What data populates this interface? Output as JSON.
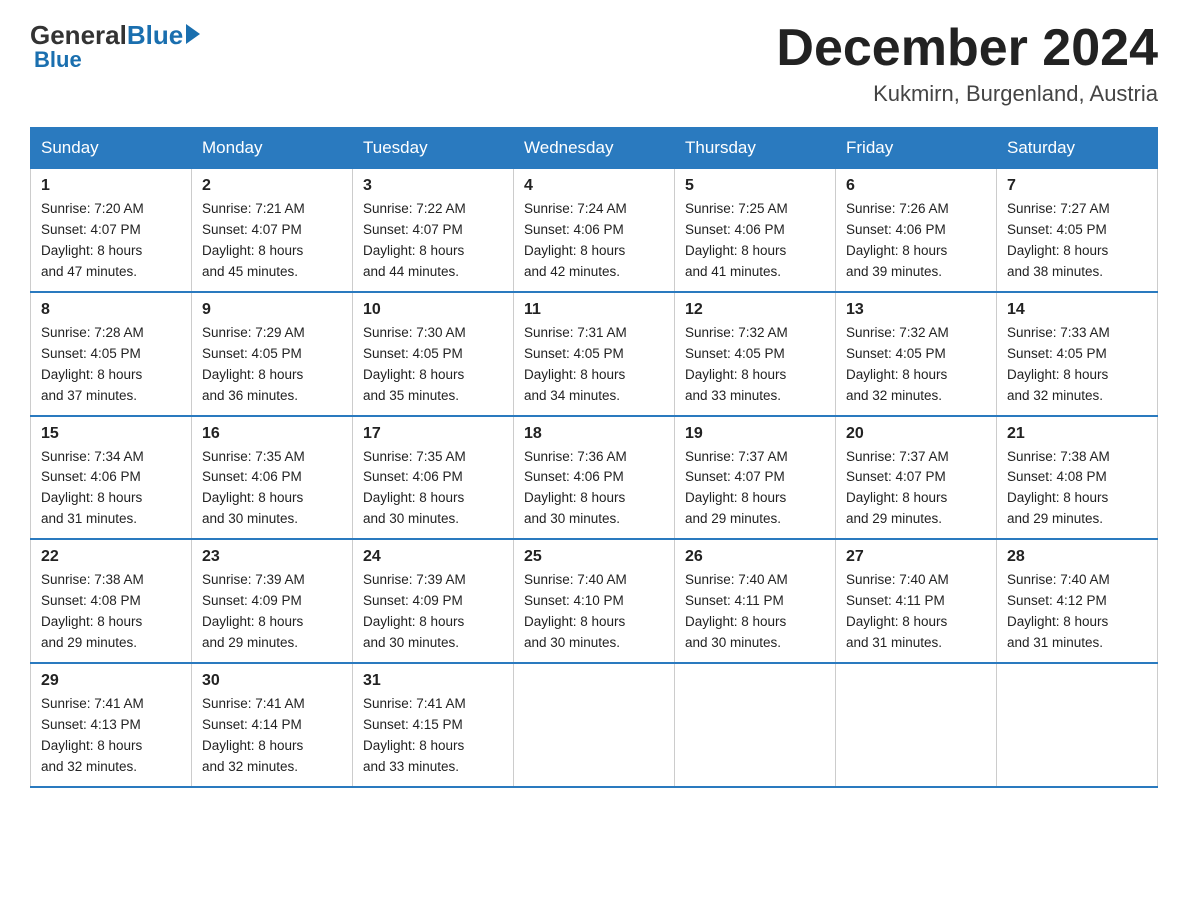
{
  "header": {
    "logo_general": "General",
    "logo_blue": "Blue",
    "month_title": "December 2024",
    "location": "Kukmirn, Burgenland, Austria"
  },
  "days_of_week": [
    "Sunday",
    "Monday",
    "Tuesday",
    "Wednesday",
    "Thursday",
    "Friday",
    "Saturday"
  ],
  "weeks": [
    [
      {
        "day": "1",
        "sunrise": "7:20 AM",
        "sunset": "4:07 PM",
        "daylight": "8 hours and 47 minutes."
      },
      {
        "day": "2",
        "sunrise": "7:21 AM",
        "sunset": "4:07 PM",
        "daylight": "8 hours and 45 minutes."
      },
      {
        "day": "3",
        "sunrise": "7:22 AM",
        "sunset": "4:07 PM",
        "daylight": "8 hours and 44 minutes."
      },
      {
        "day": "4",
        "sunrise": "7:24 AM",
        "sunset": "4:06 PM",
        "daylight": "8 hours and 42 minutes."
      },
      {
        "day": "5",
        "sunrise": "7:25 AM",
        "sunset": "4:06 PM",
        "daylight": "8 hours and 41 minutes."
      },
      {
        "day": "6",
        "sunrise": "7:26 AM",
        "sunset": "4:06 PM",
        "daylight": "8 hours and 39 minutes."
      },
      {
        "day": "7",
        "sunrise": "7:27 AM",
        "sunset": "4:05 PM",
        "daylight": "8 hours and 38 minutes."
      }
    ],
    [
      {
        "day": "8",
        "sunrise": "7:28 AM",
        "sunset": "4:05 PM",
        "daylight": "8 hours and 37 minutes."
      },
      {
        "day": "9",
        "sunrise": "7:29 AM",
        "sunset": "4:05 PM",
        "daylight": "8 hours and 36 minutes."
      },
      {
        "day": "10",
        "sunrise": "7:30 AM",
        "sunset": "4:05 PM",
        "daylight": "8 hours and 35 minutes."
      },
      {
        "day": "11",
        "sunrise": "7:31 AM",
        "sunset": "4:05 PM",
        "daylight": "8 hours and 34 minutes."
      },
      {
        "day": "12",
        "sunrise": "7:32 AM",
        "sunset": "4:05 PM",
        "daylight": "8 hours and 33 minutes."
      },
      {
        "day": "13",
        "sunrise": "7:32 AM",
        "sunset": "4:05 PM",
        "daylight": "8 hours and 32 minutes."
      },
      {
        "day": "14",
        "sunrise": "7:33 AM",
        "sunset": "4:05 PM",
        "daylight": "8 hours and 32 minutes."
      }
    ],
    [
      {
        "day": "15",
        "sunrise": "7:34 AM",
        "sunset": "4:06 PM",
        "daylight": "8 hours and 31 minutes."
      },
      {
        "day": "16",
        "sunrise": "7:35 AM",
        "sunset": "4:06 PM",
        "daylight": "8 hours and 30 minutes."
      },
      {
        "day": "17",
        "sunrise": "7:35 AM",
        "sunset": "4:06 PM",
        "daylight": "8 hours and 30 minutes."
      },
      {
        "day": "18",
        "sunrise": "7:36 AM",
        "sunset": "4:06 PM",
        "daylight": "8 hours and 30 minutes."
      },
      {
        "day": "19",
        "sunrise": "7:37 AM",
        "sunset": "4:07 PM",
        "daylight": "8 hours and 29 minutes."
      },
      {
        "day": "20",
        "sunrise": "7:37 AM",
        "sunset": "4:07 PM",
        "daylight": "8 hours and 29 minutes."
      },
      {
        "day": "21",
        "sunrise": "7:38 AM",
        "sunset": "4:08 PM",
        "daylight": "8 hours and 29 minutes."
      }
    ],
    [
      {
        "day": "22",
        "sunrise": "7:38 AM",
        "sunset": "4:08 PM",
        "daylight": "8 hours and 29 minutes."
      },
      {
        "day": "23",
        "sunrise": "7:39 AM",
        "sunset": "4:09 PM",
        "daylight": "8 hours and 29 minutes."
      },
      {
        "day": "24",
        "sunrise": "7:39 AM",
        "sunset": "4:09 PM",
        "daylight": "8 hours and 30 minutes."
      },
      {
        "day": "25",
        "sunrise": "7:40 AM",
        "sunset": "4:10 PM",
        "daylight": "8 hours and 30 minutes."
      },
      {
        "day": "26",
        "sunrise": "7:40 AM",
        "sunset": "4:11 PM",
        "daylight": "8 hours and 30 minutes."
      },
      {
        "day": "27",
        "sunrise": "7:40 AM",
        "sunset": "4:11 PM",
        "daylight": "8 hours and 31 minutes."
      },
      {
        "day": "28",
        "sunrise": "7:40 AM",
        "sunset": "4:12 PM",
        "daylight": "8 hours and 31 minutes."
      }
    ],
    [
      {
        "day": "29",
        "sunrise": "7:41 AM",
        "sunset": "4:13 PM",
        "daylight": "8 hours and 32 minutes."
      },
      {
        "day": "30",
        "sunrise": "7:41 AM",
        "sunset": "4:14 PM",
        "daylight": "8 hours and 32 minutes."
      },
      {
        "day": "31",
        "sunrise": "7:41 AM",
        "sunset": "4:15 PM",
        "daylight": "8 hours and 33 minutes."
      },
      null,
      null,
      null,
      null
    ]
  ],
  "labels": {
    "sunrise": "Sunrise:",
    "sunset": "Sunset:",
    "daylight": "Daylight:"
  }
}
